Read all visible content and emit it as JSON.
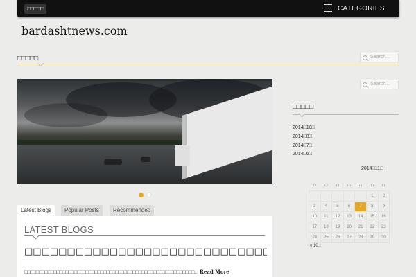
{
  "topbar": {
    "home_label": "□□□□□",
    "menu_label": "CATEGORIES"
  },
  "site": {
    "title": "bardashtnews.com"
  },
  "main": {
    "section_heading": "□□□□□"
  },
  "search": {
    "placeholder": "Search..."
  },
  "slider": {
    "active_index": 0,
    "count": 2
  },
  "tabs": [
    {
      "label": "Latest Blogs",
      "active": true
    },
    {
      "label": "Popular Posts",
      "active": false
    },
    {
      "label": "Recommended",
      "active": false
    }
  ],
  "panel": {
    "title": "LATEST BLOGS",
    "post_title": "□□□□□□□□□□□□□□□□□□□□□□□□□□□□□□□□□□□□□□□□□□□□",
    "excerpt": "□□□□□□□□□□□□□□□□□□□□□□□□□□□□□□□□□□□□□□□□□□□□□□□□□□□□□□□□□□...",
    "read_more": "Read More"
  },
  "sidebar": {
    "archive_heading": "□□□□□",
    "archives": [
      "2014□10□",
      "2014□8□",
      "2014□7□",
      "2014□6□"
    ],
    "calendar": {
      "caption": "2014□11□",
      "weekdays": [
        "□",
        "□",
        "□",
        "□",
        "□",
        "□",
        "□"
      ],
      "weeks": [
        [
          "",
          "",
          "",
          "",
          "",
          "1",
          "2"
        ],
        [
          "3",
          "4",
          "5",
          "6",
          "7",
          "8",
          "9"
        ],
        [
          "10",
          "11",
          "12",
          "13",
          "14",
          "15",
          "16"
        ],
        [
          "17",
          "18",
          "19",
          "20",
          "21",
          "22",
          "23"
        ],
        [
          "24",
          "25",
          "26",
          "27",
          "28",
          "29",
          "30"
        ]
      ],
      "today": "7",
      "prev_link": "« 10□"
    }
  },
  "colors": {
    "accent": "#e4a826",
    "topbar": "#111111",
    "rule": "#d8c27a"
  }
}
